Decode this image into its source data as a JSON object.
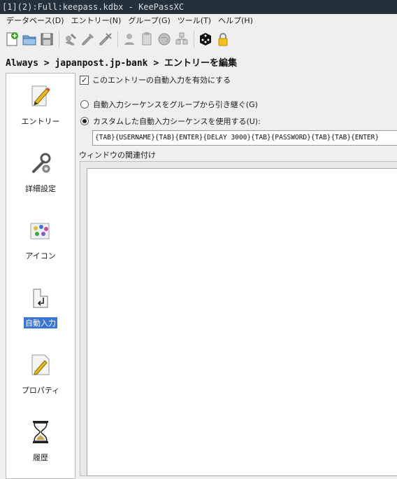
{
  "window": {
    "title": "[1](2):Full:keepass.kdbx - KeePassXC"
  },
  "menu": {
    "items": [
      "データベース(D)",
      "エントリー(N)",
      "グループ(G)",
      "ツール(T)",
      "ヘルプ(H)"
    ]
  },
  "toolbar": {
    "icons": [
      "new-database-icon",
      "open-database-icon",
      "save-database-icon",
      "add-entry-icon",
      "edit-entry-icon",
      "delete-entry-icon",
      "copy-username-icon",
      "copy-password-icon",
      "open-url-icon",
      "autotype-icon",
      "password-generator-icon",
      "lock-database-icon"
    ]
  },
  "breadcrumb": "Always > japanpost.jp-bank > エントリーを編集",
  "sidebar": {
    "items": [
      {
        "label": "エントリー",
        "icon": "entry-pencil-icon",
        "selected": false
      },
      {
        "label": "詳細設定",
        "icon": "advanced-wrench-icon",
        "selected": false
      },
      {
        "label": "アイコン",
        "icon": "icon-palette-icon",
        "selected": false
      },
      {
        "label": "自動入力",
        "icon": "autotype-keyboard-icon",
        "selected": true
      },
      {
        "label": "プロパティ",
        "icon": "properties-pencil-icon",
        "selected": false
      },
      {
        "label": "履歴",
        "icon": "history-hourglass-icon",
        "selected": false
      }
    ]
  },
  "autotype": {
    "enable_label": "このエントリーの自動入力を有効にする",
    "enable_checked": true,
    "inherit_label": "自動入力シーケンスをグループから引き継ぐ(G)",
    "custom_label": "カスタムした自動入力シーケンスを使用する(U):",
    "custom_selected": true,
    "sequence_value": "{TAB}{USERNAME}{TAB}{ENTER}{DELAY 3000}{TAB}{PASSWORD}{TAB}{TAB}{ENTER}",
    "association_label": "ウィンドウの関連付け"
  },
  "colors": {
    "titlebar": "#24313b",
    "selection": "#3875d7"
  }
}
